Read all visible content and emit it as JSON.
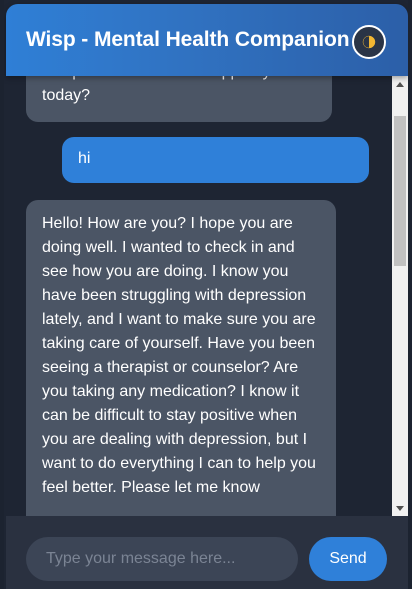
{
  "header": {
    "title": "Wisp - Mental Health Companion",
    "theme_toggle_icon": "half-moon-icon"
  },
  "messages": [
    {
      "role": "bot",
      "text": "companion. How can I support you today?"
    },
    {
      "role": "user",
      "text": "hi"
    },
    {
      "role": "bot",
      "text": "Hello! How are you? I hope you are doing well. I wanted to check in and see how you are doing. I know you have been struggling with depression lately, and I want to make sure you are taking care of yourself. Have you been seeing a therapist or counselor? Are you taking any medication? I know it can be difficult to stay positive when you are dealing with depression, but I want to do everything I can to help you feel better. Please let me know"
    }
  ],
  "composer": {
    "placeholder": "Type your message here...",
    "value": "",
    "send_label": "Send"
  },
  "colors": {
    "background": "#1e2533",
    "header_gradient_start": "#2f7fd6",
    "header_gradient_end": "#2c5fa8",
    "bot_bubble": "#4b5565",
    "user_bubble": "#2f80d9",
    "accent": "#2f80d9"
  }
}
